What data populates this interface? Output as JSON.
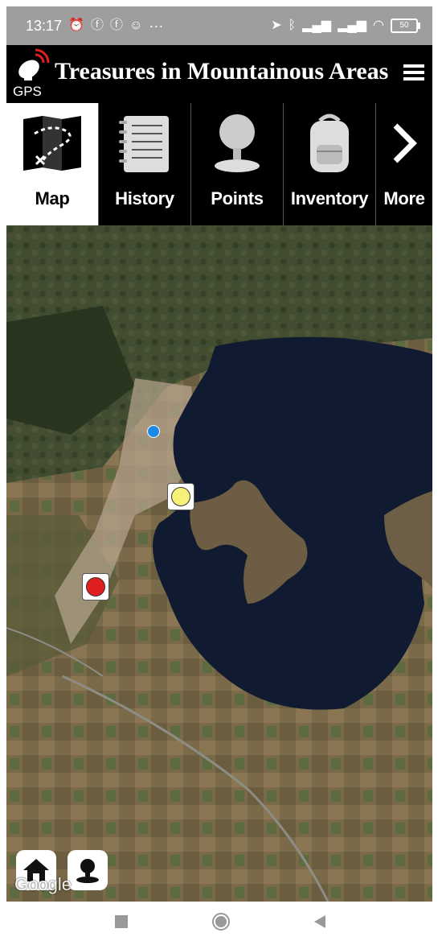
{
  "status_bar": {
    "time": "13:17",
    "extra": "···",
    "battery": "50"
  },
  "header": {
    "logo_text": "GPS",
    "title": "Treasures in Mountainous Areas"
  },
  "tabs": [
    {
      "label": "Map",
      "icon": "treasure-map-icon",
      "active": true
    },
    {
      "label": "History",
      "icon": "notebook-icon",
      "active": false
    },
    {
      "label": "Points",
      "icon": "pin-icon",
      "active": false
    },
    {
      "label": "Inventory",
      "icon": "backpack-icon",
      "active": false
    },
    {
      "label": "More",
      "icon": "chevron-right-icon",
      "active": false
    }
  ],
  "map": {
    "watermark": "Google",
    "markers": [
      {
        "color": "#f7f17a",
        "type": "yellow-point"
      },
      {
        "color": "#e02020",
        "type": "red-point"
      }
    ],
    "user_location_color": "#1e88e5"
  },
  "colors": {
    "header_bg": "#000000",
    "status_bg": "#9e9e9e",
    "active_tab_bg": "#ffffff"
  }
}
